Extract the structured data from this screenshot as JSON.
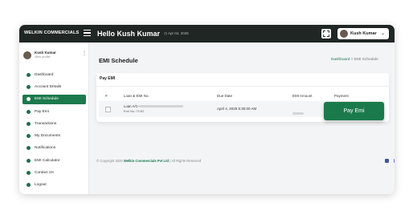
{
  "header": {
    "brand_bold": "WELKIN",
    "brand_rest": " COMMERCIALS",
    "greeting": "Hello Kush Kumar",
    "date": "Apr 04, 2025",
    "user_name": "Kush Kumar",
    "user_chevron": "⌄"
  },
  "sidebar": {
    "profile_name": "Kush Kumar",
    "profile_sub": "View profile",
    "profile_menu": "⋮",
    "items": [
      {
        "label": "Dashboard"
      },
      {
        "label": "Account Details"
      },
      {
        "label": "EMI Schedule"
      },
      {
        "label": "Pay Emi"
      },
      {
        "label": "Transactions"
      },
      {
        "label": "My Documents"
      },
      {
        "label": "Notifications"
      },
      {
        "label": "EMI Calculator"
      },
      {
        "label": "Contact Us"
      },
      {
        "label": "Logout"
      }
    ]
  },
  "main": {
    "title": "EMI Schedule",
    "crumb_link": "Dashboard",
    "crumb_sep": " > ",
    "crumb_current": "EMI Schedule"
  },
  "card": {
    "title": "Pay EMI",
    "columns": [
      "#",
      "Loan & EMI No.",
      "Due Date",
      "EMI Amount",
      "Payment"
    ],
    "row": {
      "loan_prefix": "Loan A/C-",
      "emi_no": "Emi No.:71/52",
      "due_date": "April 4, 2025 5:30:00 AM"
    }
  },
  "pay_button": "Pay Emi",
  "footer": {
    "prefix": "© Copyright 2025 ",
    "company": "Welkin Commercials Pvt Ltd",
    "suffix": " | All Rights Reserved"
  },
  "colors": {
    "accent": "#1b7a4c",
    "topbar": "#1f2623"
  }
}
